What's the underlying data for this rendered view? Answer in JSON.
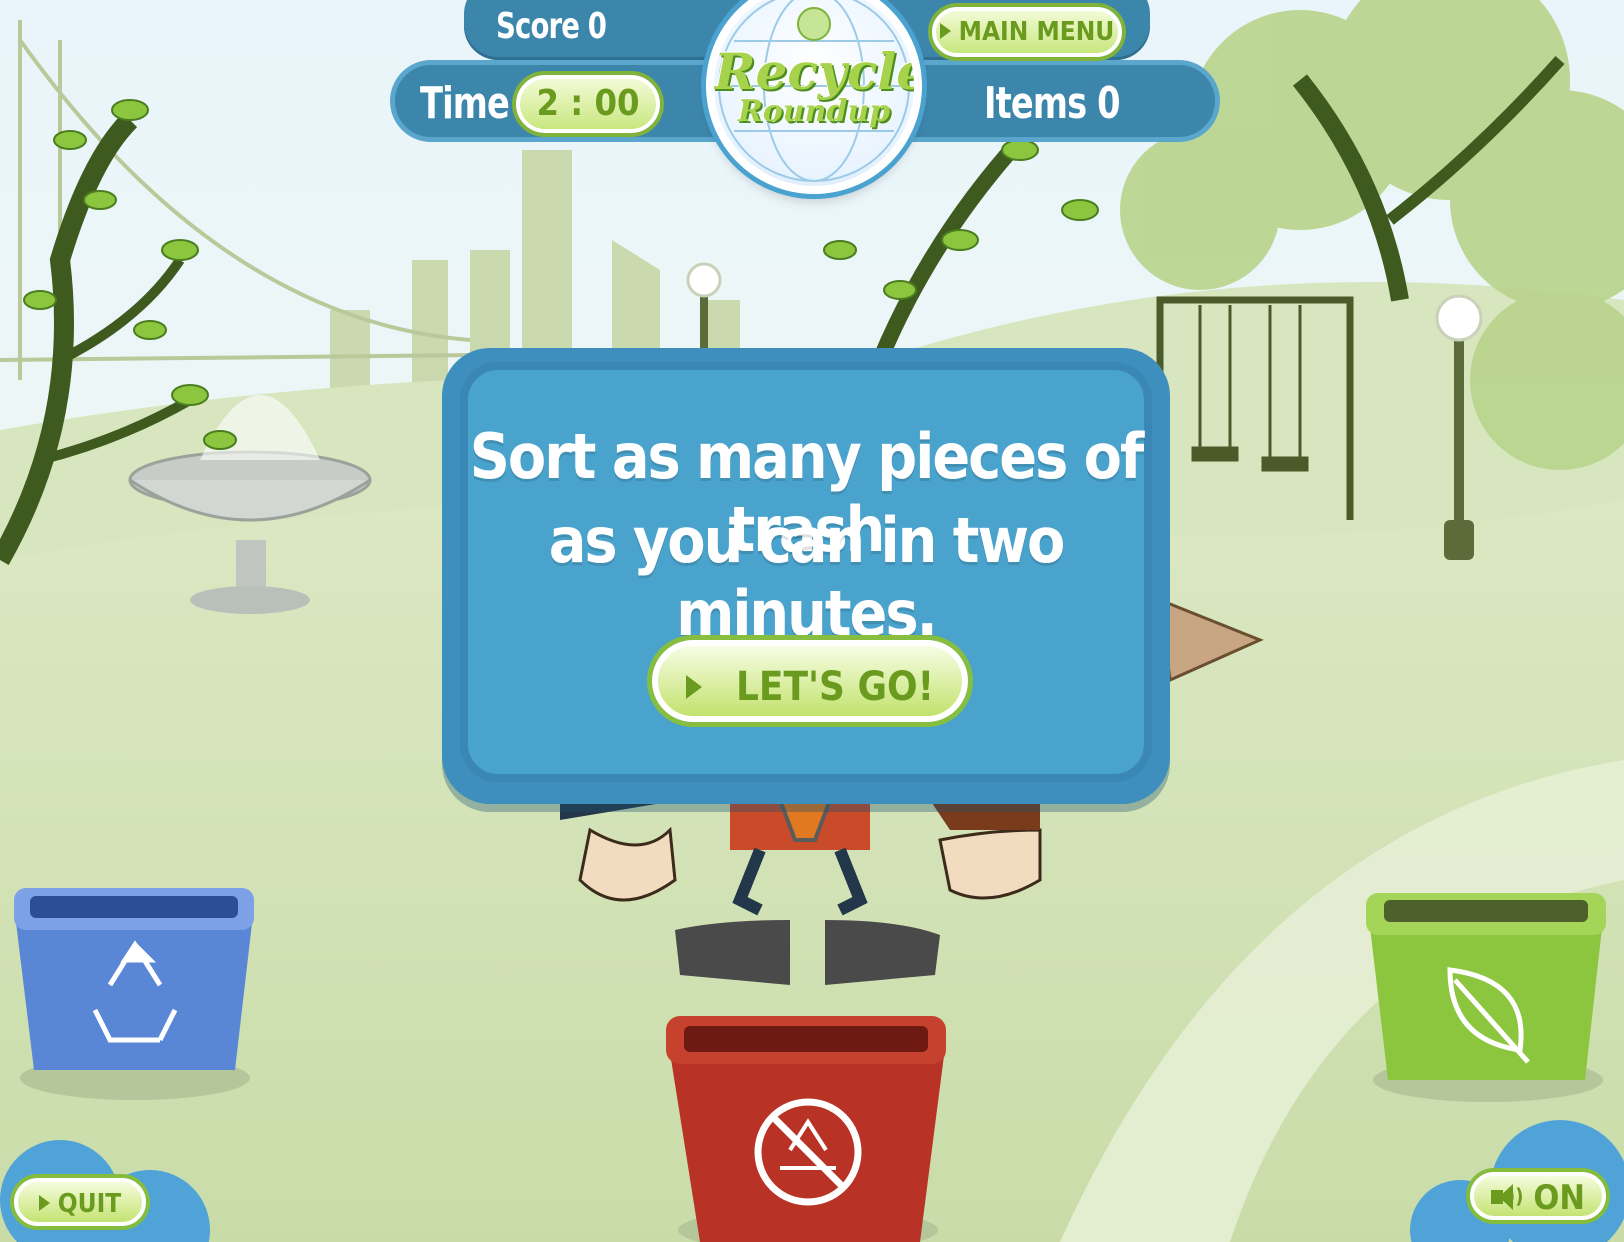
{
  "hud": {
    "score_label": "Score 0",
    "time_label": "Time",
    "timer_value": "2 : 00",
    "items_label": "Items 0",
    "main_menu_label": "MAIN MENU"
  },
  "logo": {
    "line1": "Recycle",
    "line2": "Roundup"
  },
  "dialog": {
    "line1": "Sort as many pieces of trash",
    "line2": "as you can in two minutes.",
    "button_label": "LET'S GO!"
  },
  "controls": {
    "quit_label": "QUIT",
    "sound_label": "ON"
  },
  "bins": [
    {
      "type": "recycle",
      "color": "#5a86d6",
      "icon": "recycle-icon"
    },
    {
      "type": "trash",
      "color": "#b83325",
      "icon": "no-recycle-icon"
    },
    {
      "type": "compost",
      "color": "#8cc63f",
      "icon": "leaf-icon"
    }
  ],
  "colors": {
    "hud_blue": "#3d86ab",
    "dialog_blue": "#4aa3cc",
    "button_green": "#c2e26d",
    "button_text": "#6a9a1e"
  }
}
